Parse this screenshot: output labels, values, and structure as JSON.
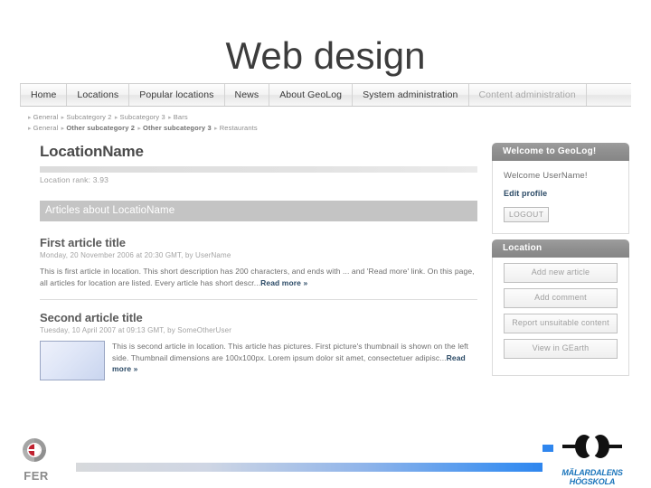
{
  "slide": {
    "title": "Web design"
  },
  "nav": {
    "items": [
      {
        "label": "Home",
        "dim": false
      },
      {
        "label": "Locations",
        "dim": false
      },
      {
        "label": "Popular locations",
        "dim": false
      },
      {
        "label": "News",
        "dim": false
      },
      {
        "label": "About GeoLog",
        "dim": false
      },
      {
        "label": "System administration",
        "dim": false
      },
      {
        "label": "Content administration",
        "dim": true
      }
    ]
  },
  "breadcrumbs": [
    {
      "parts": [
        "General",
        "Subcategory 2",
        "Subcategory 3",
        "Bars"
      ],
      "bold": false
    },
    {
      "parts": [
        "General",
        "Other subcategory 2",
        "Other subcategory 3",
        "Restaurants"
      ],
      "bold": true
    }
  ],
  "breadcrumb_separator": "▸",
  "main": {
    "page_title": "LocationName",
    "rank_text": "Location rank: 3.93",
    "section_band": "Articles about LocatioName",
    "articles": [
      {
        "title": "First article title",
        "meta": "Monday, 20 November 2006 at 20:30 GMT, by UserName",
        "body": "This is first article in location. This short description has 200 characters, and ends with ... and 'Read more' link. On this page, all articles for location are listed. Every article has short descr...",
        "read_more": "Read more »",
        "has_thumbnail": false
      },
      {
        "title": "Second article title",
        "meta": "Tuesday, 10 April 2007 at 09:13 GMT, by SomeOtherUser",
        "body": "This is second article in location. This article has pictures. First picture's thumbnail is shown on the left side. Thumbnail dimensions are 100x100px. Lorem ipsum dolor sit amet, consectetuer adipisc...",
        "read_more": "Read more »",
        "has_thumbnail": true
      }
    ]
  },
  "sidebar": {
    "welcome_panel": {
      "header": "Welcome to GeoLog!",
      "greeting": "Welcome UserName!",
      "edit_profile": "Edit profile",
      "logout": "LOGOUT"
    },
    "location_panel": {
      "header": "Location",
      "buttons": [
        "Add new article",
        "Add comment",
        "Report unsuitable content",
        "View in GEarth"
      ]
    }
  },
  "footer": {
    "left_logo_text": "FER",
    "right_logo_text": "MÄLARDALENS HÖGSKOLA"
  },
  "colors": {
    "accent_blue": "#2f86ee",
    "link_blue": "#2b4a66",
    "band_gray": "#c4c4c4",
    "panel_header_gray": "#8f8f8f",
    "mdh_blue": "#1b75bb"
  }
}
